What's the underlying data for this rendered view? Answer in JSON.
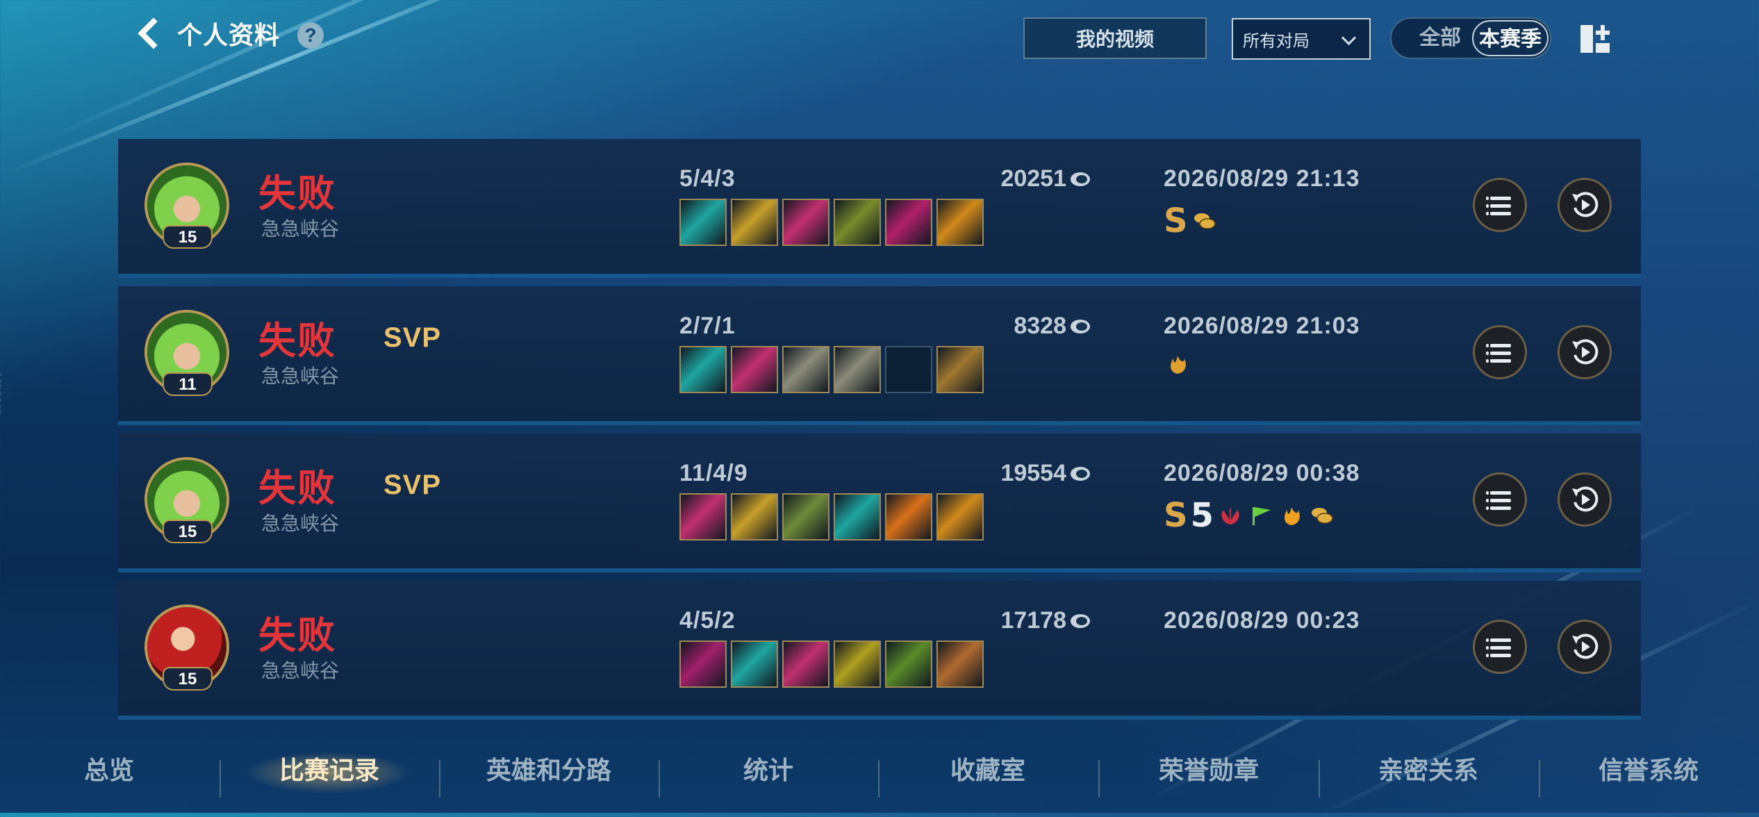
{
  "header": {
    "back_title": "个人资料",
    "help_label": "?",
    "my_video_label": "我的视频",
    "filter_selected": "所有对局",
    "toggle_all": "全部",
    "toggle_season": "本赛季"
  },
  "side_id": "1600648",
  "colors": {
    "defeat": "#e2363b",
    "accent_gold": "#e8c16a",
    "background": "#0c3562"
  },
  "matches": [
    {
      "level": "15",
      "result": "失败",
      "mode": "急急峡谷",
      "svp": "",
      "kda": "5/4/3",
      "gold": "20251",
      "datetime": "2026/08/29 21:13",
      "badges": [
        "S",
        "coins-icon"
      ],
      "hero": "green-hair-hero"
    },
    {
      "level": "11",
      "result": "失败",
      "mode": "急急峡谷",
      "svp": "SVP",
      "kda": "2/7/1",
      "gold": "8328",
      "datetime": "2026/08/29 21:03",
      "badges": [
        "flame-hand-icon"
      ],
      "hero": "green-hair-hero"
    },
    {
      "level": "15",
      "result": "失败",
      "mode": "急急峡谷",
      "svp": "SVP",
      "kda": "11/4/9",
      "gold": "19554",
      "datetime": "2026/08/29 00:38",
      "badges": [
        "S",
        "5",
        "lotus-icon",
        "flag-icon",
        "fire-icon",
        "coins-icon"
      ],
      "hero": "green-hair-hero"
    },
    {
      "level": "15",
      "result": "失败",
      "mode": "急急峡谷",
      "svp": "",
      "kda": "4/5/2",
      "gold": "17178",
      "datetime": "2026/08/29 00:23",
      "badges": [],
      "hero": "red-hair-hero"
    }
  ],
  "nav": {
    "tabs": [
      "总览",
      "比赛记录",
      "英雄和分路",
      "统计",
      "收藏室",
      "荣誉勋章",
      "亲密关系",
      "信誉系统"
    ],
    "active": "比赛记录"
  }
}
